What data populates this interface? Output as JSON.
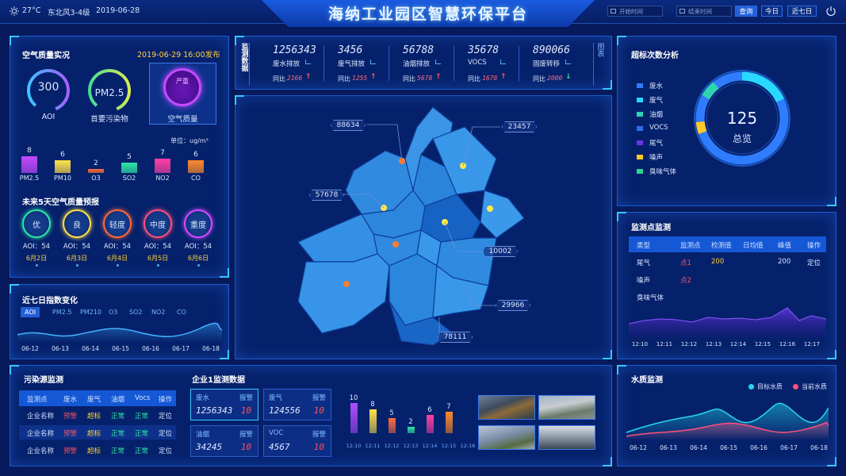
{
  "header": {
    "weather": "27°C",
    "wind": "东北风3-4级",
    "date": "2019-06-28",
    "title": "海纳工业园区智慧环保平台",
    "start_placeholder": "开始时间",
    "end_placeholder": "结束时间",
    "query": "查询",
    "today": "今日",
    "seven": "近七日"
  },
  "air": {
    "title": "空气质量实况",
    "publish": "2019-06-29 16:00发布",
    "aqi_value": "300",
    "aqi_label": "AOI",
    "primary_value": "PM2.5",
    "primary_label": "首要污染物",
    "level_value": "严重",
    "level_label": "空气质量",
    "unit": "单位：ug/m³",
    "bars": [
      {
        "name": "PM2.5",
        "value": 8,
        "label": "8"
      },
      {
        "name": "PM10",
        "value": 6,
        "label": "6"
      },
      {
        "name": "O3",
        "value": 2,
        "label": "2"
      },
      {
        "name": "SO2",
        "value": 5,
        "label": "5"
      },
      {
        "name": "NO2",
        "value": 7,
        "label": "7"
      },
      {
        "name": "CO",
        "value": 6,
        "label": "6"
      }
    ],
    "forecast_title": "未来5天空气质量预报",
    "forecast": [
      {
        "level": "优",
        "aqi": "AOI：54",
        "date": "6月2日"
      },
      {
        "level": "良",
        "aqi": "AOI：54",
        "date": "6月3日"
      },
      {
        "level": "轻度",
        "aqi": "AOI：54",
        "date": "6月4日"
      },
      {
        "level": "中度",
        "aqi": "AOI：54",
        "date": "6月5日"
      },
      {
        "level": "重度",
        "aqi": "AOI：54",
        "date": "6月6日"
      }
    ]
  },
  "seven": {
    "title": "近七日指数变化",
    "tabs": [
      "AOI",
      "PM2.5",
      "PM210",
      "O3",
      "SO2",
      "NO2",
      "CO"
    ],
    "dates": [
      "06-12",
      "06-13",
      "06-14",
      "06-15",
      "06-16",
      "06-17",
      "06-18"
    ]
  },
  "monitor": {
    "side_label": "监测数据",
    "side_right": "图表",
    "items": [
      {
        "value": "1256343",
        "name": "废水排放",
        "yoy": "同比",
        "delta": "2166",
        "dir": "↑"
      },
      {
        "value": "3456",
        "name": "废气排放",
        "yoy": "同比",
        "delta": "1255",
        "dir": "↑"
      },
      {
        "value": "56788",
        "name": "油烟排放",
        "yoy": "同比",
        "delta": "5678",
        "dir": "↑"
      },
      {
        "value": "35678",
        "name": "VOCS",
        "yoy": "同比",
        "delta": "1678",
        "dir": "↑"
      },
      {
        "value": "890066",
        "name": "固废转移",
        "yoy": "同比",
        "delta": "2000",
        "dir": "↓"
      }
    ]
  },
  "map": {
    "tags": [
      "88634",
      "23457",
      "57678",
      "10002",
      "29966",
      "78111"
    ]
  },
  "exceed": {
    "title": "超标次数分析",
    "legend": [
      {
        "name": "废水",
        "color": "#2f7cff"
      },
      {
        "name": "废气",
        "color": "#28d8ff"
      },
      {
        "name": "油烟",
        "color": "#2fd3b0"
      },
      {
        "name": "VOCS",
        "color": "#2f6df0"
      },
      {
        "name": "尾气",
        "color": "#6a34e8"
      },
      {
        "name": "噪声",
        "color": "#ffc928"
      },
      {
        "name": "臭味气体",
        "color": "#2ed590"
      }
    ],
    "total": "125",
    "total_label": "总览"
  },
  "station": {
    "title": "监测点监测",
    "headers": [
      "类型",
      "监测点",
      "检测值",
      "日均值",
      "峰值",
      "操作"
    ],
    "rows": [
      {
        "type": "尾气",
        "point": "点1",
        "value": "200",
        "avg": "",
        "peak": "200",
        "op": "定位"
      },
      {
        "type": "噪声",
        "point": "点2",
        "value": "",
        "avg": "",
        "peak": "",
        "op": ""
      },
      {
        "type": "臭味气体",
        "point": "",
        "value": "",
        "avg": "",
        "peak": "",
        "op": ""
      }
    ],
    "times": [
      "12:10",
      "12:11",
      "12:12",
      "12:13",
      "12:14",
      "12:15",
      "12:16",
      "12:17"
    ]
  },
  "pollution": {
    "title": "污染源监测",
    "headers": [
      "监测点",
      "废水",
      "废气",
      "油烟",
      "Vocs",
      "操作"
    ],
    "rows": [
      [
        "企业名称",
        "预警",
        "超标",
        "正常",
        "正常",
        "定位"
      ],
      [
        "企业名称",
        "预警",
        "超标",
        "正常",
        "正常",
        "定位"
      ],
      [
        "企业名称",
        "预警",
        "超标",
        "正常",
        "正常",
        "定位"
      ]
    ]
  },
  "company": {
    "title": "企业1监测数据",
    "cards": [
      {
        "name": "废水",
        "alarm": "报警",
        "value": "1256343",
        "num": "10"
      },
      {
        "name": "废气",
        "alarm": "报警",
        "value": "124556",
        "num": "10"
      },
      {
        "name": "油烟",
        "alarm": "报警",
        "value": "34245",
        "num": "10"
      },
      {
        "name": "VOC",
        "alarm": "报警",
        "value": "4567",
        "num": "10"
      }
    ],
    "bars": [
      {
        "time": "12:10",
        "value": 10,
        "label": "10",
        "color": "#b14cff"
      },
      {
        "time": "12:11",
        "value": 8,
        "label": "8",
        "color": "#ffe14a"
      },
      {
        "time": "12:12",
        "value": 5,
        "label": "5",
        "color": "#ff6a3c"
      },
      {
        "time": "12:13",
        "value": 2,
        "label": "2",
        "color": "#2ee6a6"
      },
      {
        "time": "12:14",
        "value": 6,
        "label": "6",
        "color": "#ff3fa6"
      },
      {
        "time": "12:15",
        "value": 7,
        "label": "7",
        "color": "#ff8a2a"
      }
    ],
    "extra_time": "12:16"
  },
  "water": {
    "title": "水质监测",
    "legend_target": "目标水质",
    "legend_current": "当前水质",
    "dates": [
      "06-12",
      "06-13",
      "06-14",
      "06-15",
      "06-16",
      "06-17",
      "06-18"
    ]
  }
}
